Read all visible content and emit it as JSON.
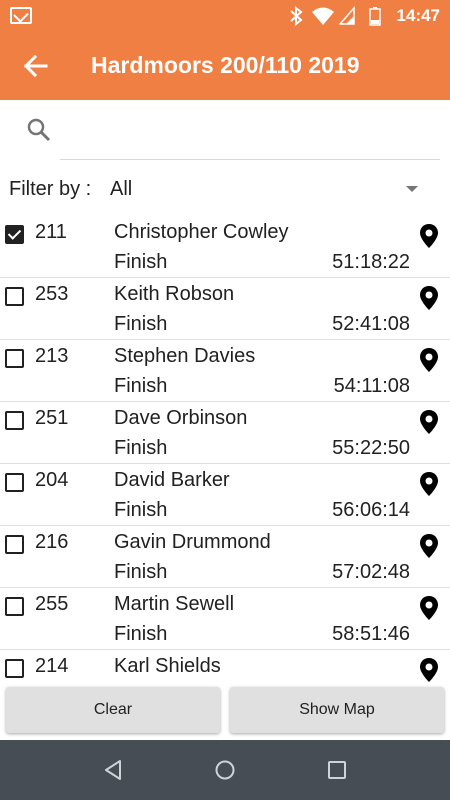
{
  "status_bar": {
    "time": "14:47",
    "icons": [
      "mail-icon",
      "bluetooth-icon",
      "wifi-icon",
      "signal-icon",
      "battery-icon"
    ]
  },
  "toolbar": {
    "title": "Hardmoors 200/110 2019",
    "back_icon": "arrow-back-icon",
    "color": "#f07f43"
  },
  "search": {
    "placeholder": "",
    "value": ""
  },
  "filter": {
    "label": "Filter by :",
    "value": "All"
  },
  "runners": [
    {
      "number": "211",
      "name": "Christopher Cowley",
      "status": "Finish",
      "time": "51:18:22",
      "checked": true
    },
    {
      "number": "253",
      "name": "Keith Robson",
      "status": "Finish",
      "time": "52:41:08",
      "checked": false
    },
    {
      "number": "213",
      "name": "Stephen Davies",
      "status": "Finish",
      "time": "54:11:08",
      "checked": false
    },
    {
      "number": "251",
      "name": "Dave Orbinson",
      "status": "Finish",
      "time": "55:22:50",
      "checked": false
    },
    {
      "number": "204",
      "name": "David Barker",
      "status": "Finish",
      "time": "56:06:14",
      "checked": false
    },
    {
      "number": "216",
      "name": "Gavin Drummond",
      "status": "Finish",
      "time": "57:02:48",
      "checked": false
    },
    {
      "number": "255",
      "name": "Martin Sewell",
      "status": "Finish",
      "time": "58:51:46",
      "checked": false
    },
    {
      "number": "214",
      "name": "Karl Shields",
      "status": "",
      "time": "",
      "checked": false
    }
  ],
  "buttons": {
    "clear": "Clear",
    "show_map": "Show Map"
  },
  "nav": {
    "icons": [
      "back-nav-icon",
      "home-nav-icon",
      "recents-nav-icon"
    ]
  }
}
